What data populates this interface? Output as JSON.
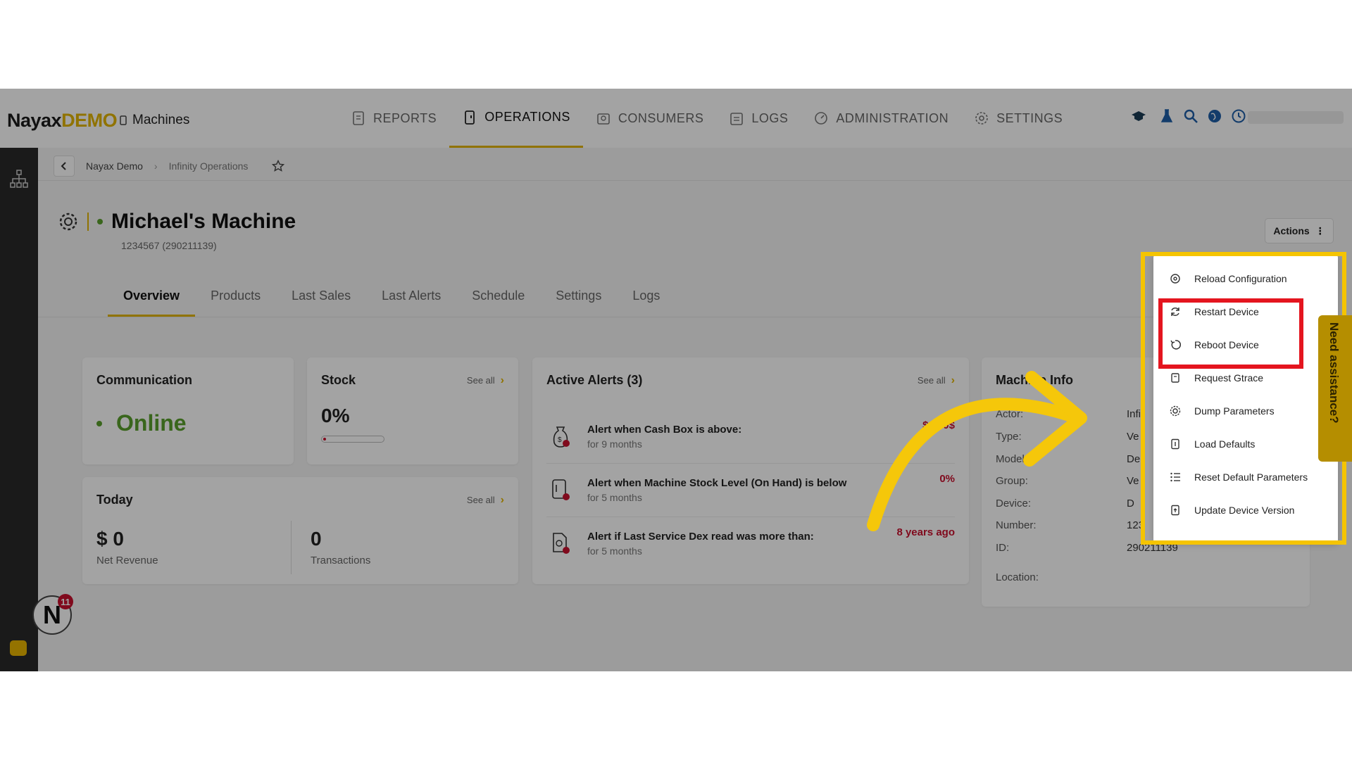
{
  "brand": {
    "name": "Nayax",
    "suffix": "DEMO"
  },
  "header": {
    "section": "Machines"
  },
  "nav": [
    {
      "label": "REPORTS",
      "icon": "report-icon"
    },
    {
      "label": "OPERATIONS",
      "icon": "operations-icon"
    },
    {
      "label": "CONSUMERS",
      "icon": "consumers-icon"
    },
    {
      "label": "LOGS",
      "icon": "logs-icon"
    },
    {
      "label": "ADMINISTRATION",
      "icon": "administration-icon"
    },
    {
      "label": "SETTINGS",
      "icon": "settings-icon"
    }
  ],
  "breadcrumb": [
    "Nayax Demo",
    "Infinity Operations"
  ],
  "machine": {
    "name": "Michael's Machine",
    "id_line": "1234567 (290211139)"
  },
  "actions": {
    "label": "Actions"
  },
  "tabs": [
    "Overview",
    "Products",
    "Last Sales",
    "Last Alerts",
    "Schedule",
    "Settings",
    "Logs"
  ],
  "communication": {
    "title": "Communication",
    "status": "Online"
  },
  "stock": {
    "title": "Stock",
    "see_all": "See all",
    "value": "0%",
    "fill_fraction": 0.0
  },
  "today": {
    "title": "Today",
    "see_all": "See all",
    "revenue": "$ 0",
    "revenue_label": "Net Revenue",
    "transactions": "0",
    "transactions_label": "Transactions"
  },
  "alerts": {
    "title": "Active Alerts (3)",
    "see_all": "See all",
    "items": [
      {
        "title": "Alert when Cash Box is above:",
        "sub": "for 9 months",
        "value": "$0.00$"
      },
      {
        "title": "Alert when Machine Stock Level (On Hand) is below",
        "sub": "for 5 months",
        "value": "0%"
      },
      {
        "title": "Alert if Last Service Dex read was more than:",
        "sub": "for 5 months",
        "value": "8 years ago"
      }
    ]
  },
  "machine_info": {
    "title": "Machine Info",
    "rows": [
      {
        "key": "Actor:",
        "value": "Infi"
      },
      {
        "key": "Type:",
        "value": "Ve"
      },
      {
        "key": "Model:",
        "value": "De"
      },
      {
        "key": "Group:",
        "value": "Ve"
      },
      {
        "key": "Device:",
        "value": "D"
      },
      {
        "key": "Number:",
        "value": "123"
      },
      {
        "key": "ID:",
        "value": "290211139"
      },
      {
        "key": "Location:",
        "value": ""
      }
    ]
  },
  "menu": {
    "items": [
      {
        "label": "Reload Configuration",
        "icon": "reload-config-icon"
      },
      {
        "label": "Restart Device",
        "icon": "restart-icon"
      },
      {
        "label": "Reboot Device",
        "icon": "reboot-icon"
      },
      {
        "label": "Request Gtrace",
        "icon": "gtrace-icon"
      },
      {
        "label": "Dump Parameters",
        "icon": "dump-icon"
      },
      {
        "label": "Load Defaults",
        "icon": "load-defaults-icon"
      },
      {
        "label": "Reset Default Parameters",
        "icon": "reset-list-icon"
      },
      {
        "label": "Update Device Version",
        "icon": "update-icon"
      }
    ]
  },
  "assist": {
    "label": "Need assistance?"
  },
  "notifications": {
    "count": "11"
  },
  "colors": {
    "accent": "#e2b400",
    "online": "#5aa02c",
    "alert": "#c8102e",
    "highlight_yellow": "#f5c400",
    "highlight_red": "#e4151f"
  }
}
